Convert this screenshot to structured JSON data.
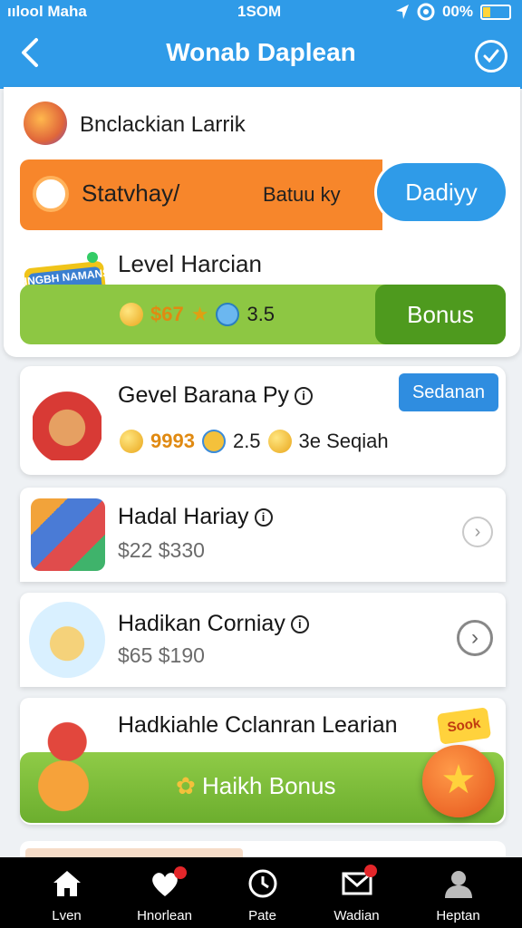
{
  "status_bar": {
    "carrier": "ıılool Maha",
    "time": "1SOM",
    "battery": "00%"
  },
  "header": {
    "title": "Wonab Daplean",
    "back_icon": "chevron-left-icon",
    "action_icon": "check-circle-icon"
  },
  "user": {
    "name": "Bnclackian Larrik"
  },
  "promo": {
    "label": "Statvhay/",
    "sub": "Batuu ky",
    "button": "Dadiyy"
  },
  "level": {
    "title": "Level Harcian",
    "coins": "$67",
    "time": "3.5",
    "button": "Bonus",
    "badge_text": "HNGBH NAMANS"
  },
  "items": [
    {
      "title": "Gevel Barana Py",
      "tag": "Sedanan",
      "coins": "9993",
      "time": "2.5",
      "extra": "3e Seqiah"
    },
    {
      "title": "Hadal Hariay",
      "price": "$22 $330"
    },
    {
      "title": "Hadikan Corniay",
      "price": "$65 $190"
    },
    {
      "title": "Hadkiahle Cclanran Learian",
      "sale": "Sook",
      "bonus": "Haikh Bonus"
    }
  ],
  "nav": [
    {
      "label": "Lven",
      "icon": "home-icon"
    },
    {
      "label": "Hnorlean",
      "icon": "heart-icon"
    },
    {
      "label": "Pate",
      "icon": "clock-icon"
    },
    {
      "label": "Wadian",
      "icon": "mail-icon"
    },
    {
      "label": "Heptan",
      "icon": "profile-icon"
    }
  ],
  "colors": {
    "primary": "#2f9be8",
    "orange": "#f7862b",
    "green": "#8dc743",
    "dark_green": "#4e9a1e",
    "nav_bg": "#000000"
  }
}
